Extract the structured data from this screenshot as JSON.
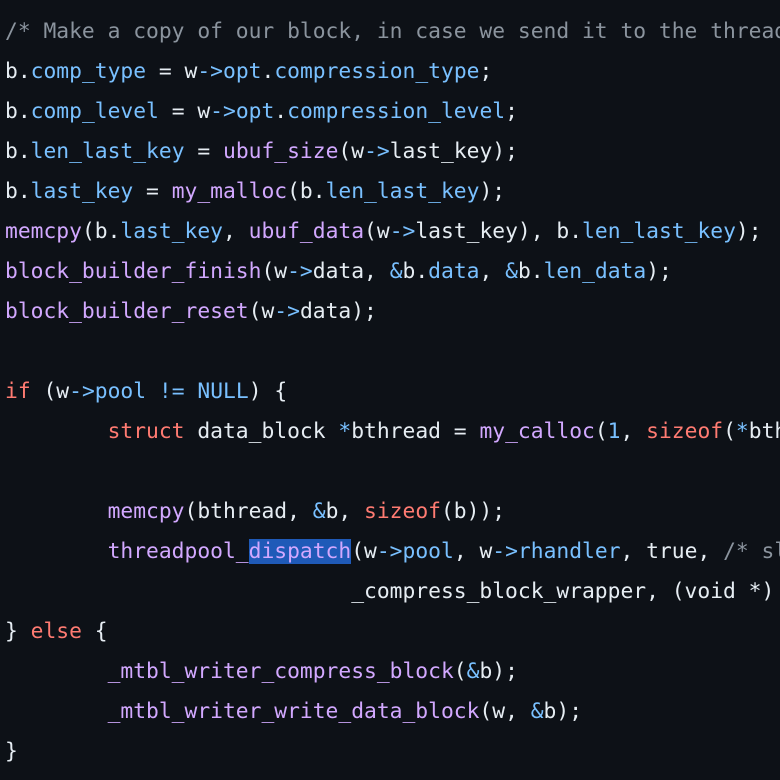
{
  "editor": {
    "lines": [
      [
        [
          "c",
          "/* Make a copy of our block, in case we send it to the threadpool. */"
        ]
      ],
      [
        [
          "t",
          "b."
        ],
        [
          "p",
          "comp_type"
        ],
        [
          "t",
          " = w"
        ],
        [
          "p",
          "->"
        ],
        [
          "p",
          "opt"
        ],
        [
          "t",
          "."
        ],
        [
          "p",
          "compression_type"
        ],
        [
          "t",
          ";"
        ]
      ],
      [
        [
          "t",
          "b."
        ],
        [
          "p",
          "comp_level"
        ],
        [
          "t",
          " = w"
        ],
        [
          "p",
          "->"
        ],
        [
          "p",
          "opt"
        ],
        [
          "t",
          "."
        ],
        [
          "p",
          "compression_level"
        ],
        [
          "t",
          ";"
        ]
      ],
      [
        [
          "t",
          "b."
        ],
        [
          "p",
          "len_last_key"
        ],
        [
          "t",
          " = "
        ],
        [
          "f",
          "ubuf_size"
        ],
        [
          "t",
          "(w"
        ],
        [
          "p",
          "->"
        ],
        [
          "t",
          "last_key);"
        ]
      ],
      [
        [
          "t",
          "b."
        ],
        [
          "p",
          "last_key"
        ],
        [
          "t",
          " = "
        ],
        [
          "f",
          "my_malloc"
        ],
        [
          "t",
          "(b."
        ],
        [
          "p",
          "len_last_key"
        ],
        [
          "t",
          ");"
        ]
      ],
      [
        [
          "f",
          "memcpy"
        ],
        [
          "t",
          "(b."
        ],
        [
          "p",
          "last_key"
        ],
        [
          "t",
          ", "
        ],
        [
          "f",
          "ubuf_data"
        ],
        [
          "t",
          "(w"
        ],
        [
          "p",
          "->"
        ],
        [
          "t",
          "last_key), b."
        ],
        [
          "p",
          "len_last_key"
        ],
        [
          "t",
          ");"
        ]
      ],
      [
        [
          "f",
          "block_builder_finish"
        ],
        [
          "t",
          "(w"
        ],
        [
          "p",
          "->"
        ],
        [
          "t",
          "data, "
        ],
        [
          "p",
          "&"
        ],
        [
          "t",
          "b."
        ],
        [
          "p",
          "data"
        ],
        [
          "t",
          ", "
        ],
        [
          "p",
          "&"
        ],
        [
          "t",
          "b."
        ],
        [
          "p",
          "len_data"
        ],
        [
          "t",
          ");"
        ]
      ],
      [
        [
          "f",
          "block_builder_reset"
        ],
        [
          "t",
          "(w"
        ],
        [
          "p",
          "->"
        ],
        [
          "t",
          "data);"
        ]
      ],
      [],
      [
        [
          "k",
          "if"
        ],
        [
          "t",
          " (w"
        ],
        [
          "p",
          "->"
        ],
        [
          "p",
          "pool"
        ],
        [
          "t",
          " "
        ],
        [
          "p",
          "!="
        ],
        [
          "t",
          " "
        ],
        [
          "p",
          "NULL"
        ],
        [
          "t",
          ") {"
        ]
      ],
      [
        [
          "t",
          "        "
        ],
        [
          "k",
          "struct"
        ],
        [
          "t",
          " data_block "
        ],
        [
          "p",
          "*"
        ],
        [
          "t",
          "bthread = "
        ],
        [
          "f",
          "my_calloc"
        ],
        [
          "t",
          "("
        ],
        [
          "p",
          "1"
        ],
        [
          "t",
          ", "
        ],
        [
          "k",
          "sizeof"
        ],
        [
          "t",
          "("
        ],
        [
          "p",
          "*"
        ],
        [
          "t",
          "bthread));"
        ]
      ],
      [],
      [
        [
          "t",
          "        "
        ],
        [
          "f",
          "memcpy"
        ],
        [
          "t",
          "(bthread, "
        ],
        [
          "p",
          "&"
        ],
        [
          "t",
          "b, "
        ],
        [
          "k",
          "sizeof"
        ],
        [
          "t",
          "(b));"
        ]
      ],
      [
        [
          "t",
          "        "
        ],
        [
          "f",
          "threadpool_"
        ],
        [
          "fs",
          "dispatch"
        ],
        [
          "t",
          "(w"
        ],
        [
          "p",
          "->"
        ],
        [
          "p",
          "pool"
        ],
        [
          "t",
          ", w"
        ],
        [
          "p",
          "->"
        ],
        [
          "p",
          "rhandler"
        ],
        [
          "t",
          ", true, "
        ],
        [
          "c",
          "/* sleep */"
        ]
      ],
      [
        [
          "t",
          "                           _compress_block_wrapper, (void *) bthread);"
        ]
      ],
      [
        [
          "t",
          "} "
        ],
        [
          "k",
          "else"
        ],
        [
          "t",
          " {"
        ]
      ],
      [
        [
          "t",
          "        "
        ],
        [
          "f",
          "_mtbl_writer_compress_block"
        ],
        [
          "t",
          "("
        ],
        [
          "p",
          "&"
        ],
        [
          "t",
          "b);"
        ]
      ],
      [
        [
          "t",
          "        "
        ],
        [
          "f",
          "_mtbl_writer_write_data_block"
        ],
        [
          "t",
          "(w, "
        ],
        [
          "p",
          "&"
        ],
        [
          "t",
          "b);"
        ]
      ],
      [
        [
          "t",
          "}"
        ]
      ]
    ],
    "colors": {
      "background": "#0d1117",
      "text": "#e6edf3",
      "comment": "#8b949e",
      "property": "#79c0ff",
      "function": "#d2a8ff",
      "keyword": "#ff7b72",
      "selection": "#1f5ab8"
    }
  }
}
